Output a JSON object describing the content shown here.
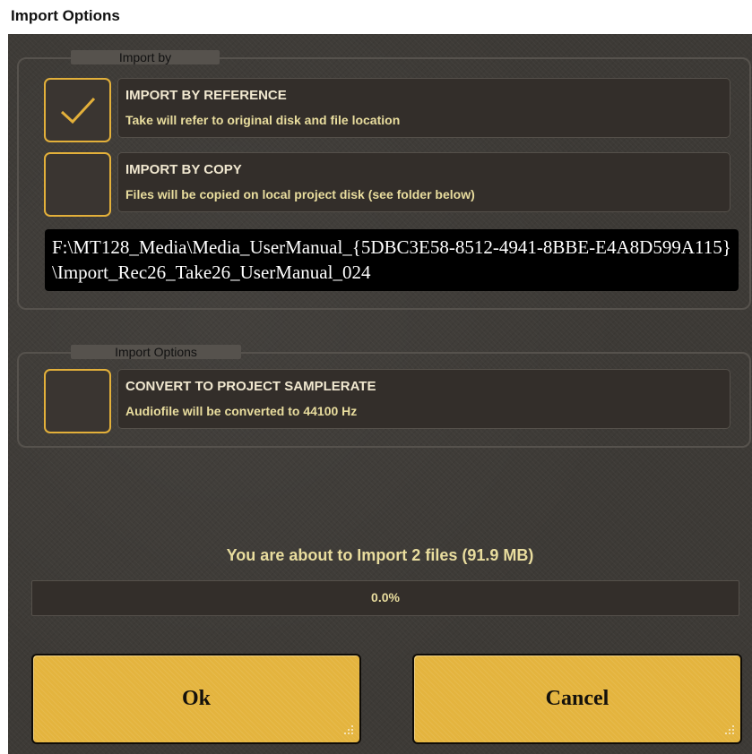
{
  "window": {
    "title": "Import Options"
  },
  "import_by": {
    "legend": "Import by",
    "options": [
      {
        "title": "IMPORT BY REFERENCE",
        "description": "Take will refer to original disk and file location",
        "checked": true
      },
      {
        "title": "IMPORT BY COPY",
        "description": "Files will be copied on local project disk (see folder below)",
        "checked": false
      }
    ],
    "folder_path": "F:\\MT128_Media\\Media_UserManual_{5DBC3E58-8512-4941-8BBE-E4A8D599A115}\\Import_Rec26_Take26_UserManual_024"
  },
  "import_options": {
    "legend": "Import Options",
    "options": [
      {
        "title": "CONVERT TO PROJECT SAMPLERATE",
        "description": "Audiofile will be converted to 44100 Hz",
        "checked": false
      }
    ]
  },
  "summary": "You are about to Import 2 files (91.9 MB)",
  "progress": {
    "label": "0.0%",
    "value": 0.0
  },
  "buttons": {
    "ok": "Ok",
    "cancel": "Cancel"
  },
  "colors": {
    "accent": "#e3b03a",
    "panel_bg": "#3d3a36",
    "option_bg": "#332e2a",
    "option_title": "#f1e8d0",
    "option_desc": "#e9dd9e",
    "button_bg": "#e4b43e"
  },
  "icons": {
    "check": "check-icon",
    "resize_grip": "resize-grip-icon"
  }
}
